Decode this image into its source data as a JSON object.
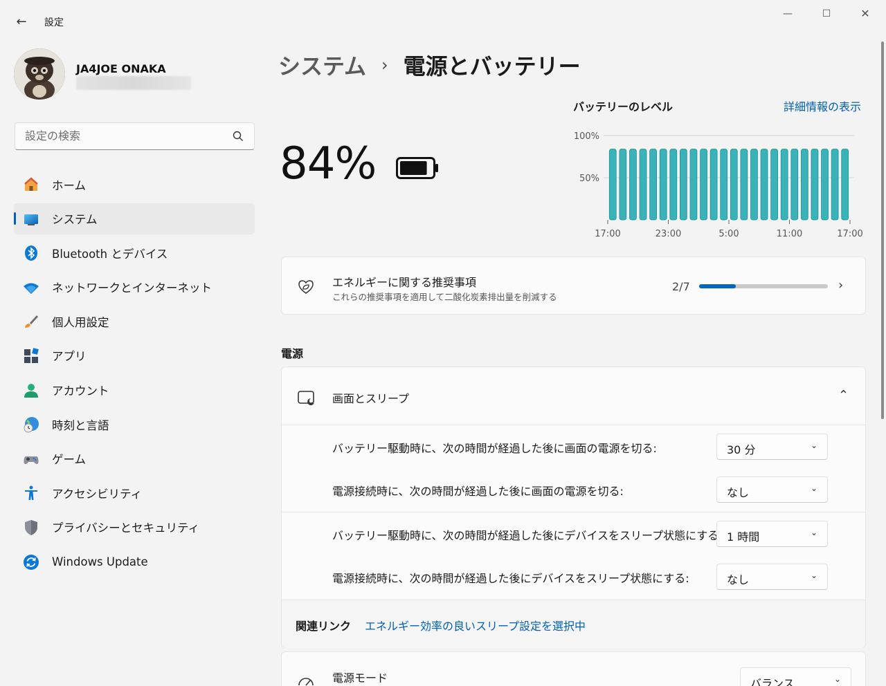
{
  "window": {
    "title": "設定",
    "back_icon": "←",
    "minimize_icon": "—",
    "maximize_icon": "☐",
    "close_icon": "✕"
  },
  "profile": {
    "name": "JA4JOE ONAKA"
  },
  "search": {
    "placeholder": "設定の検索"
  },
  "nav": {
    "items": [
      {
        "label": "ホーム",
        "icon": "home-icon"
      },
      {
        "label": "システム",
        "icon": "system-icon",
        "active": true
      },
      {
        "label": "Bluetooth とデバイス",
        "icon": "bluetooth-icon"
      },
      {
        "label": "ネットワークとインターネット",
        "icon": "wifi-icon"
      },
      {
        "label": "個人用設定",
        "icon": "brush-icon"
      },
      {
        "label": "アプリ",
        "icon": "apps-icon"
      },
      {
        "label": "アカウント",
        "icon": "account-icon"
      },
      {
        "label": "時刻と言語",
        "icon": "time-language-icon"
      },
      {
        "label": "ゲーム",
        "icon": "gamepad-icon"
      },
      {
        "label": "アクセシビリティ",
        "icon": "accessibility-icon"
      },
      {
        "label": "プライバシーとセキュリティ",
        "icon": "shield-icon"
      },
      {
        "label": "Windows Update",
        "icon": "update-icon"
      }
    ]
  },
  "breadcrumb": {
    "parent": "システム",
    "separator": "›",
    "current": "電源とバッテリー"
  },
  "battery": {
    "percent_text": "84%",
    "level": 0.84
  },
  "chart_data": {
    "type": "bar",
    "title": "バッテリーのレベル",
    "link": "詳細情報の表示",
    "y_ticks": [
      "100%",
      "50%"
    ],
    "ylim": [
      0,
      100
    ],
    "x_ticks": [
      "17:00",
      "23:00",
      "5:00",
      "11:00",
      "17:00"
    ],
    "values": [
      84,
      84,
      84,
      84,
      84,
      84,
      84,
      84,
      84,
      84,
      84,
      84,
      84,
      84,
      84,
      84,
      84,
      84,
      84,
      84,
      84,
      84,
      84,
      84
    ],
    "bar_color": "#3ab3b8",
    "grid": true
  },
  "energy": {
    "title": "エネルギーに関する推奨事項",
    "subtitle": "これらの推奨事項を適用して二酸化炭素排出量を削減する",
    "progress_text": "2/7",
    "progress": 0.2857,
    "chevron": "›"
  },
  "power_section": {
    "title": "電源"
  },
  "sleep": {
    "title": "画面とスリープ",
    "chevron": "⌃",
    "settings": [
      {
        "label": "バッテリー駆動時に、次の時間が経過した後に画面の電源を切る:",
        "value": "30 分"
      },
      {
        "label": "電源接続時に、次の時間が経過した後に画面の電源を切る:",
        "value": "なし"
      },
      {
        "label": "バッテリー駆動時に、次の時間が経過した後にデバイスをスリープ状態にする:",
        "value": "1 時間"
      },
      {
        "label": "電源接続時に、次の時間が経過した後にデバイスをスリープ状態にする:",
        "value": "なし"
      }
    ],
    "dropdown_chevron": "⌄",
    "related_label": "関連リンク",
    "related_link": "エネルギー効率の良いスリープ設定を選択中"
  },
  "power_mode": {
    "title": "電源モード",
    "value": "バランス"
  },
  "colors": {
    "accent": "#005fb8",
    "progress": "#0067c0",
    "chart_bar": "#3ab3b8"
  }
}
